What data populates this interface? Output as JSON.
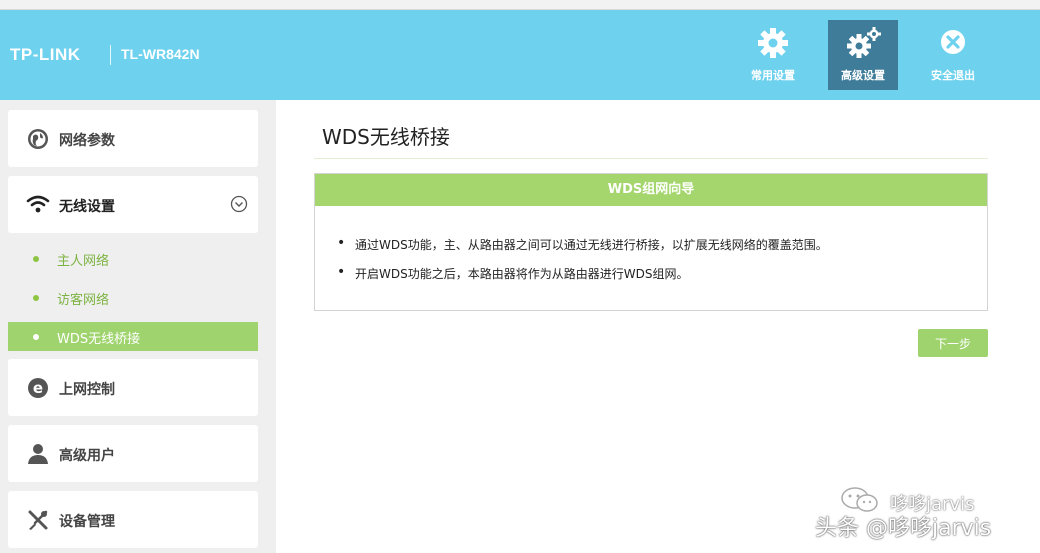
{
  "header": {
    "logo": "TP-LINK",
    "model": "TL-WR842N",
    "buttons": [
      {
        "label": "常用设置",
        "icon": "gear-icon"
      },
      {
        "label": "高级设置",
        "icon": "gears-icon",
        "active": true
      },
      {
        "label": "安全退出",
        "icon": "close-icon"
      }
    ]
  },
  "sidebar": {
    "items": [
      {
        "label": "网络参数",
        "icon": "globe-icon"
      },
      {
        "label": "无线设置",
        "icon": "wifi-icon",
        "expanded": true
      },
      {
        "label": "上网控制",
        "icon": "ie-icon"
      },
      {
        "label": "高级用户",
        "icon": "user-icon"
      },
      {
        "label": "设备管理",
        "icon": "tools-icon"
      }
    ],
    "subitems": [
      {
        "label": "主人网络"
      },
      {
        "label": "访客网络"
      },
      {
        "label": "WDS无线桥接",
        "active": true
      }
    ]
  },
  "main": {
    "title": "WDS无线桥接",
    "panel_title": "WDS组网向导",
    "bullets": [
      "通过WDS功能，主、从路由器之间可以通过无线进行桥接，以扩展无线网络的覆盖范围。",
      "开启WDS功能之后，本路由器将作为从路由器进行WDS组网。"
    ],
    "next_button": "下一步"
  },
  "watermark": {
    "line1": "哆哆jarvis",
    "line2": "头条 @哆哆jarvis"
  },
  "colors": {
    "header": "#6ed2ef",
    "active_header_button": "#3f7c99",
    "accent_green": "#9ed36d"
  }
}
